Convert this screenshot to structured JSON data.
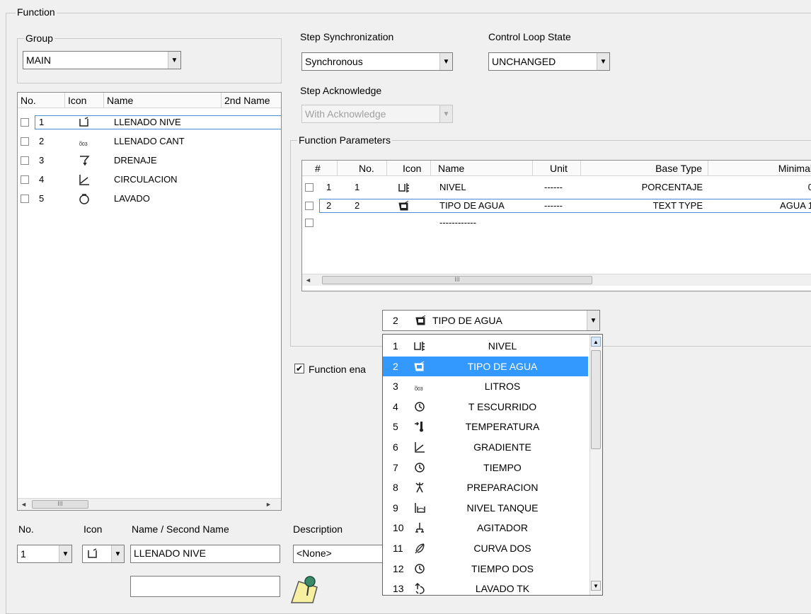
{
  "function_group_title": "Function",
  "group": {
    "title": "Group",
    "value": "MAIN"
  },
  "functions_list": {
    "columns": [
      "No.",
      "Icon",
      "Name",
      "2nd Name"
    ],
    "rows": [
      {
        "no": "1",
        "name": "LLENADO NIVE",
        "icon": "tank-fill-icon"
      },
      {
        "no": "2",
        "name": "LLENADO CANT",
        "icon": "counter-icon"
      },
      {
        "no": "3",
        "name": "DRENAJE",
        "icon": "drain-icon"
      },
      {
        "no": "4",
        "name": "CIRCULACION",
        "icon": "gradient-icon"
      },
      {
        "no": "5",
        "name": "LAVADO",
        "icon": "wash-icon"
      }
    ],
    "scroll_thumb": "III"
  },
  "step_sync": {
    "label": "Step Synchronization",
    "value": "Synchronous"
  },
  "control_loop": {
    "label": "Control Loop State",
    "value": "UNCHANGED"
  },
  "step_ack": {
    "label": "Step Acknowledge",
    "value": "With Acknowledge"
  },
  "function_params": {
    "title": "Function Parameters",
    "columns": [
      "#",
      "No.",
      "Icon",
      "Name",
      "Unit",
      "Base Type",
      "Minimal"
    ],
    "rows": [
      {
        "hash": "1",
        "no": "1",
        "name": "NIVEL",
        "unit": "------",
        "base": "PORCENTAJE",
        "min": "0"
      },
      {
        "hash": "2",
        "no": "2",
        "name": "TIPO DE AGUA",
        "unit": "------",
        "base": "TEXT TYPE",
        "min": "AGUA 1"
      },
      {
        "hash": "",
        "no": "",
        "name": "------------",
        "unit": "",
        "base": "",
        "min": ""
      }
    ],
    "scroll_thumb": "III"
  },
  "param_combo": {
    "num": "2",
    "value": "TIPO DE AGUA"
  },
  "dropdown_items": [
    {
      "num": "1",
      "label": "NIVEL",
      "icon": "level-icon"
    },
    {
      "num": "2",
      "label": "TIPO DE AGUA",
      "icon": "water-type-icon"
    },
    {
      "num": "3",
      "label": "LITROS",
      "icon": "counter-icon"
    },
    {
      "num": "4",
      "label": "T ESCURRIDO",
      "icon": "clock-icon"
    },
    {
      "num": "5",
      "label": "TEMPERATURA",
      "icon": "thermometer-icon"
    },
    {
      "num": "6",
      "label": "GRADIENTE",
      "icon": "gradient-icon"
    },
    {
      "num": "7",
      "label": "TIEMPO",
      "icon": "clock-icon"
    },
    {
      "num": "8",
      "label": "PREPARACION",
      "icon": "preparation-icon"
    },
    {
      "num": "9",
      "label": "NIVEL TANQUE",
      "icon": "tank-level-icon"
    },
    {
      "num": "10",
      "label": "AGITADOR",
      "icon": "agitator-icon"
    },
    {
      "num": "11",
      "label": "CURVA DOS",
      "icon": "curve-icon"
    },
    {
      "num": "12",
      "label": "TIEMPO DOS",
      "icon": "clock-icon"
    },
    {
      "num": "13",
      "label": "LAVADO TK",
      "icon": "wash-tank-icon"
    }
  ],
  "function_enabled": {
    "label": "Function ena",
    "checked": true
  },
  "bottom": {
    "no_label": "No.",
    "icon_label": "Icon",
    "name_label": "Name / Second Name",
    "desc_label": "Description",
    "no_value": "1",
    "name_value": "LLENADO NIVE",
    "second_name_value": "",
    "desc_value": "<None>"
  }
}
